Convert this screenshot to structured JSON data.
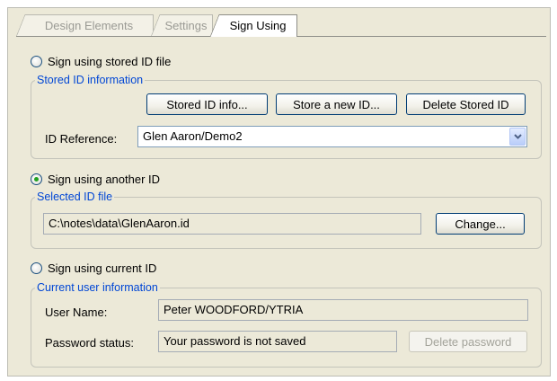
{
  "tabs": [
    {
      "label": "Design Elements"
    },
    {
      "label": "Settings"
    },
    {
      "label": "Sign Using"
    }
  ],
  "stored_option": {
    "label": "Sign using stored ID file",
    "checked": false
  },
  "stored_group": {
    "legend": "Stored ID information",
    "info_button": "Stored ID info...",
    "new_button": "Store a new ID...",
    "delete_button": "Delete Stored ID",
    "id_reference_label": "ID Reference:",
    "id_reference_value": "Glen Aaron/Demo2"
  },
  "another_option": {
    "label": "Sign using another ID",
    "checked": true
  },
  "selected_group": {
    "legend": "Selected ID file",
    "path": "C:\\notes\\data\\GlenAaron.id",
    "change_button": "Change..."
  },
  "current_option": {
    "label": "Sign using current ID",
    "checked": false
  },
  "current_group": {
    "legend": "Current user information",
    "user_name_label": "User Name:",
    "user_name_value": "Peter WOODFORD/YTRIA",
    "password_label": "Password status:",
    "password_value": "Your password is not saved",
    "delete_password_button": "Delete password"
  },
  "colors": {
    "panel": "#ece9d8",
    "legend_text": "#0046d5",
    "radio_dot": "#21a121",
    "disabled_text": "#a3a39a"
  }
}
